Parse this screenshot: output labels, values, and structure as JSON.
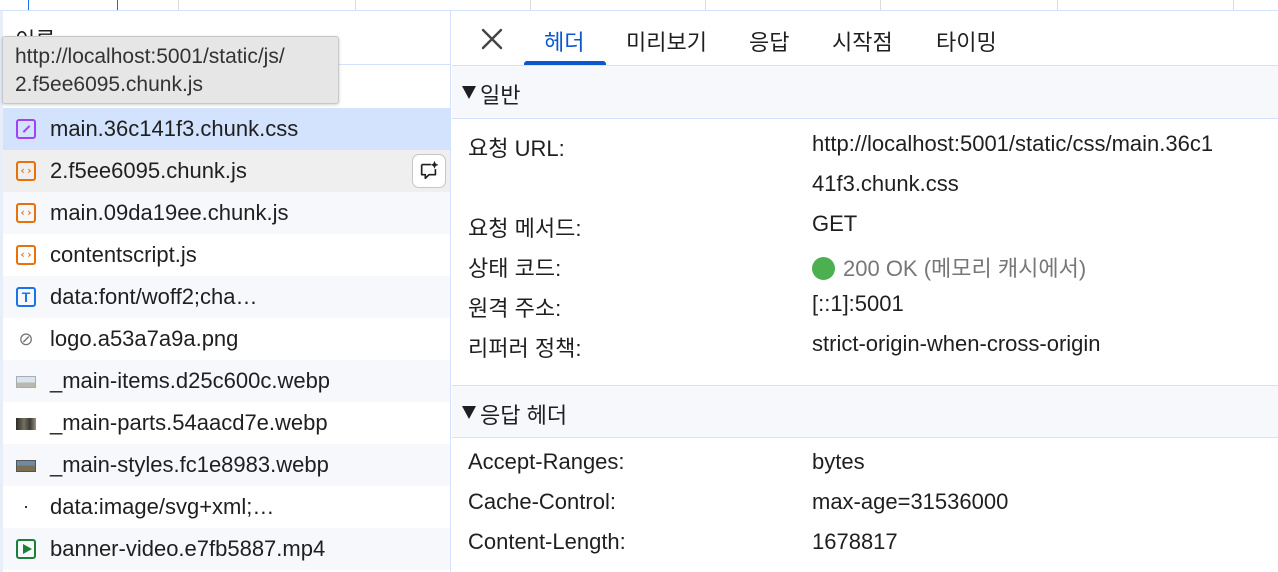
{
  "list": {
    "column_header": "이름",
    "tooltip": [
      "http://localhost:5001/static/js/",
      "2.f5ee6095.chunk.js"
    ],
    "rows": [
      {
        "name": "",
        "icon": "none"
      },
      {
        "name": "main.36c141f3.chunk.css",
        "icon": "css-file-icon"
      },
      {
        "name": "2.f5ee6095.chunk.js",
        "icon": "js-file-icon"
      },
      {
        "name": "main.09da19ee.chunk.js",
        "icon": "js-file-icon"
      },
      {
        "name": "contentscript.js",
        "icon": "js-file-icon"
      },
      {
        "name": "data:font/woff2;cha…",
        "icon": "font-file-icon"
      },
      {
        "name": "logo.a53a7a9a.png",
        "icon": "link-icon"
      },
      {
        "name": "_main-items.d25c600c.webp",
        "icon": "image-thumbnail-icon"
      },
      {
        "name": "_main-parts.54aacd7e.webp",
        "icon": "image-thumbnail-icon"
      },
      {
        "name": "_main-styles.fc1e8983.webp",
        "icon": "image-thumbnail-icon"
      },
      {
        "name": "data:image/svg+xml;…",
        "icon": "svg-thumbnail-icon"
      },
      {
        "name": "banner-video.e7fb5887.mp4",
        "icon": "video-file-icon"
      }
    ]
  },
  "tabs": [
    "헤더",
    "미리보기",
    "응답",
    "시작점",
    "타이밍"
  ],
  "general": {
    "title": "일반",
    "url_label": "요청 URL:",
    "url_value_1": "http://localhost:5001/static/css/main.36c1",
    "url_value_2": "41f3.chunk.css",
    "method_label": "요청 메서드:",
    "method_value": "GET",
    "status_label": "상태 코드:",
    "status_value": "200 OK (메모리 캐시에서)",
    "remote_label": "원격 주소:",
    "remote_value": "[::1]:5001",
    "policy_label": "리퍼러 정책:",
    "policy_value": "strict-origin-when-cross-origin"
  },
  "response": {
    "title": "응답 헤더",
    "accept_ranges_label": "Accept-Ranges:",
    "accept_ranges_value": "bytes",
    "cache_control_label": "Cache-Control:",
    "cache_control_value": "max-age=31536000",
    "content_length_label": "Content-Length:",
    "content_length_value": "1678817"
  },
  "colors": {
    "accent": "#0b57d0",
    "status_ok": "#4caf50",
    "selected_row": "#d3e3fd"
  }
}
